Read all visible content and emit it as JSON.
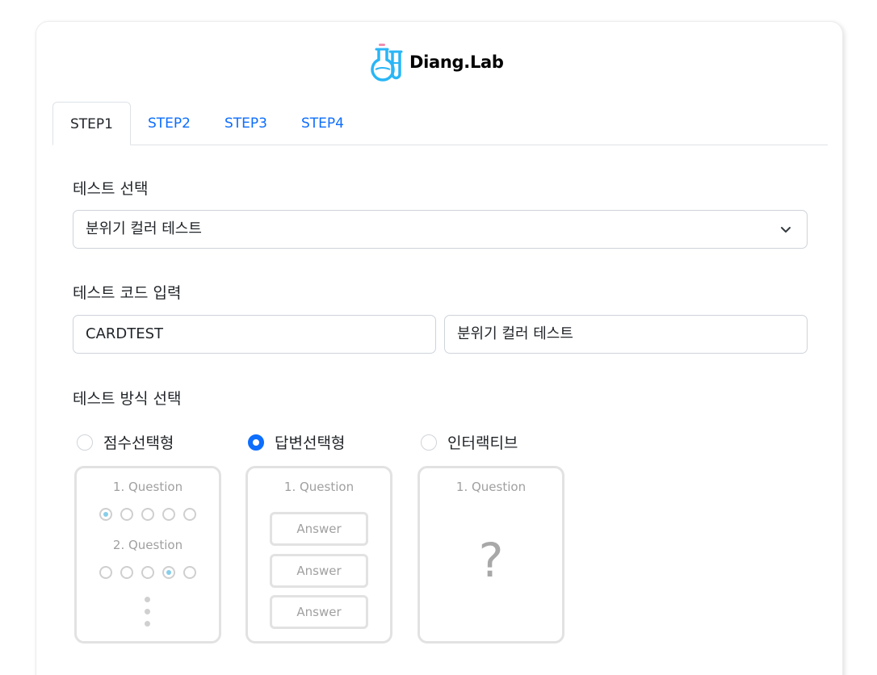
{
  "brand": {
    "name": "Diang.Lab",
    "icon": "flask-tube-logo",
    "color": "#29b6f6"
  },
  "tabs": [
    {
      "label": "STEP1",
      "active": true
    },
    {
      "label": "STEP2",
      "active": false
    },
    {
      "label": "STEP3",
      "active": false
    },
    {
      "label": "STEP4",
      "active": false
    }
  ],
  "test_select": {
    "label": "테스트 선택",
    "value": "분위기 컬러 테스트",
    "icon": "chevron-down-icon"
  },
  "test_code": {
    "label": "테스트 코드 입력",
    "code_value": "CARDTEST",
    "name_value": "분위기 컬러 테스트"
  },
  "test_method": {
    "label": "테스트 방식 선택",
    "options": [
      {
        "label": "점수선택형",
        "checked": false
      },
      {
        "label": "답변선택형",
        "checked": true
      },
      {
        "label": "인터랙티브",
        "checked": false
      }
    ],
    "previews": {
      "score": {
        "q1": "1. Question",
        "q2": "2. Question"
      },
      "answer": {
        "q1": "1. Question",
        "answers": [
          "Answer",
          "Answer",
          "Answer"
        ]
      },
      "interactive": {
        "q1": "1. Question",
        "mark": "?"
      }
    }
  },
  "colors": {
    "accent": "#0d6efd",
    "tab_link": "#0d6efd",
    "preview_border": "#e2e2e2"
  }
}
